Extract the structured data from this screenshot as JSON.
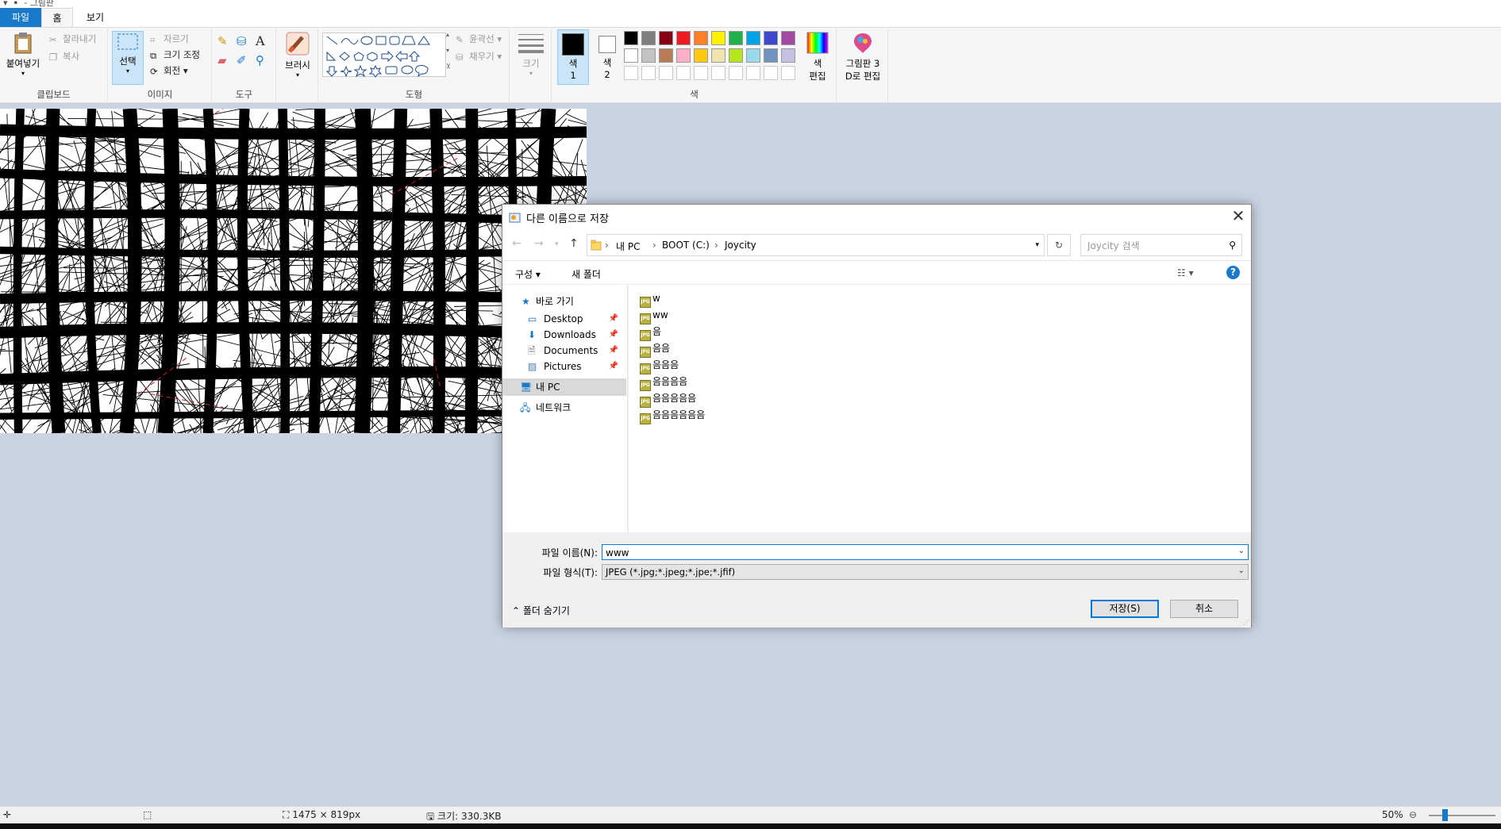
{
  "app": {
    "quick_access": "▾ ▪️ - 그림판",
    "tabs": {
      "file": "파일",
      "home": "홈",
      "view": "보기"
    }
  },
  "ribbon": {
    "clipboard": {
      "paste": "붙여넣기",
      "cut": "잘라내기",
      "copy": "복사",
      "label": "클립보드"
    },
    "image": {
      "select": "선택",
      "crop": "자르기",
      "resize": "크기 조정",
      "rotate": "회전",
      "label": "이미지"
    },
    "tools": {
      "label": "도구",
      "text_glyph": "A"
    },
    "brushes": {
      "label": "브러시"
    },
    "shapes": {
      "outline": "윤곽선",
      "fill": "채우기",
      "label": "도형"
    },
    "size": {
      "label": "크기"
    },
    "colors": {
      "color1_label": "색",
      "color1_num": "1",
      "color2_label": "색",
      "color2_num": "2",
      "edit_colors_line1": "색",
      "edit_colors_line2": "편집",
      "label": "색",
      "color1_value": "#000000",
      "color2_value": "#ffffff",
      "palette_row1": [
        "#000000",
        "#7f7f7f",
        "#880015",
        "#ed1c24",
        "#ff7f27",
        "#fff200",
        "#22b14c",
        "#00a2e8",
        "#3f48cc",
        "#a349a4"
      ],
      "palette_row2": [
        "#ffffff",
        "#c3c3c3",
        "#b97a57",
        "#ffaec9",
        "#ffc90e",
        "#efe4b0",
        "#b5e61d",
        "#99d9ea",
        "#7092be",
        "#c8bfe7"
      ]
    },
    "paint3d": {
      "line1": "그림판 3",
      "line2": "D로 편집"
    }
  },
  "status": {
    "dimensions": "1475 × 819px",
    "filesize": "크기: 330.3KB",
    "zoom": "50%"
  },
  "dialog": {
    "title": "다른 이름으로 저장",
    "close": "✕",
    "path": [
      "내 PC",
      "BOOT (C:)",
      "Joycity"
    ],
    "search_placeholder": "Joycity 검색",
    "toolbar": {
      "organize": "구성 ▾",
      "new_folder": "새 폴더",
      "help": "?"
    },
    "nav": {
      "quick_access": "바로 가기",
      "desktop": "Desktop",
      "downloads": "Downloads",
      "documents": "Documents",
      "pictures": "Pictures",
      "this_pc": "내 PC",
      "network": "네트워크"
    },
    "files": [
      "w",
      "ww",
      "음",
      "음음",
      "음음음",
      "음음음음",
      "음음음음음",
      "음음음음음음"
    ],
    "file_icon_text": "JPG",
    "filename_label": "파일 이름(N):",
    "filename_value": "www",
    "filetype_label": "파일 형식(T):",
    "filetype_value": "JPEG (*.jpg;*.jpeg;*.jpe;*.jfif)",
    "save": "저장(S)",
    "cancel": "취소",
    "hide_folders": "폴더 숨기기"
  }
}
